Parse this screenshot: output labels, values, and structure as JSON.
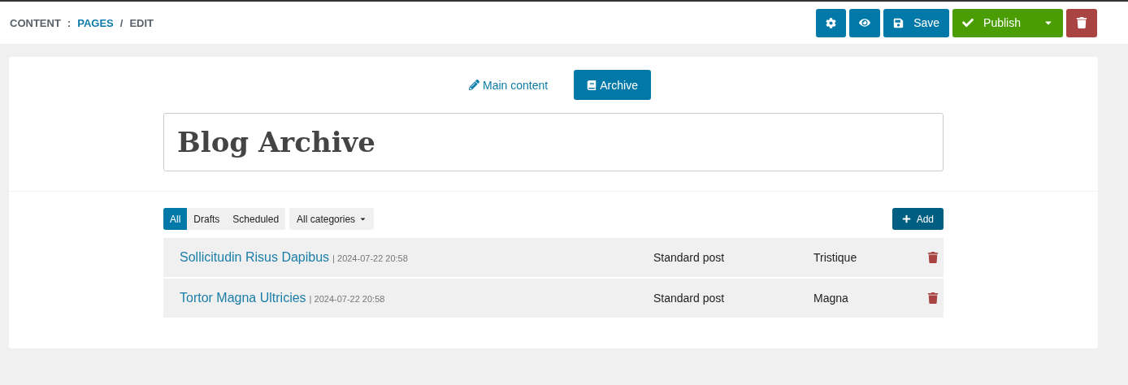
{
  "breadcrumb": [
    {
      "kind": "text",
      "label": "CONTENT"
    },
    {
      "kind": "separator",
      "label": ":"
    },
    {
      "kind": "link",
      "label": "PAGES"
    },
    {
      "kind": "separator",
      "label": "/"
    },
    {
      "kind": "text",
      "label": "EDIT"
    }
  ],
  "toolbar": [
    {
      "kind": "settings"
    },
    {
      "kind": "preview"
    },
    {
      "kind": "save",
      "label": "Save"
    },
    {
      "kind": "publish",
      "label": "Publish"
    },
    {
      "kind": "delete"
    }
  ],
  "tabs": [
    {
      "label": "Main content",
      "kind": "edit",
      "selected": false
    },
    {
      "label": "Archive",
      "kind": "archive",
      "selected": true
    }
  ],
  "title": {
    "value": "Blog Archive"
  },
  "filters": [
    {
      "label": "All",
      "selected": true
    },
    {
      "label": "Drafts",
      "selected": false
    },
    {
      "label": "Scheduled",
      "selected": false
    }
  ],
  "category_dropdown": {
    "label": "All categories"
  },
  "add_button": {
    "label": "Add"
  },
  "posts": [
    {
      "title": "Sollicitudin Risus Dapibus",
      "date": "| 2024-07-22 20:58",
      "type": "Standard post",
      "category": "Tristique"
    },
    {
      "title": "Tortor Magna Ultricies",
      "date": "| 2024-07-22 20:58",
      "type": "Standard post",
      "category": "Magna"
    }
  ]
}
